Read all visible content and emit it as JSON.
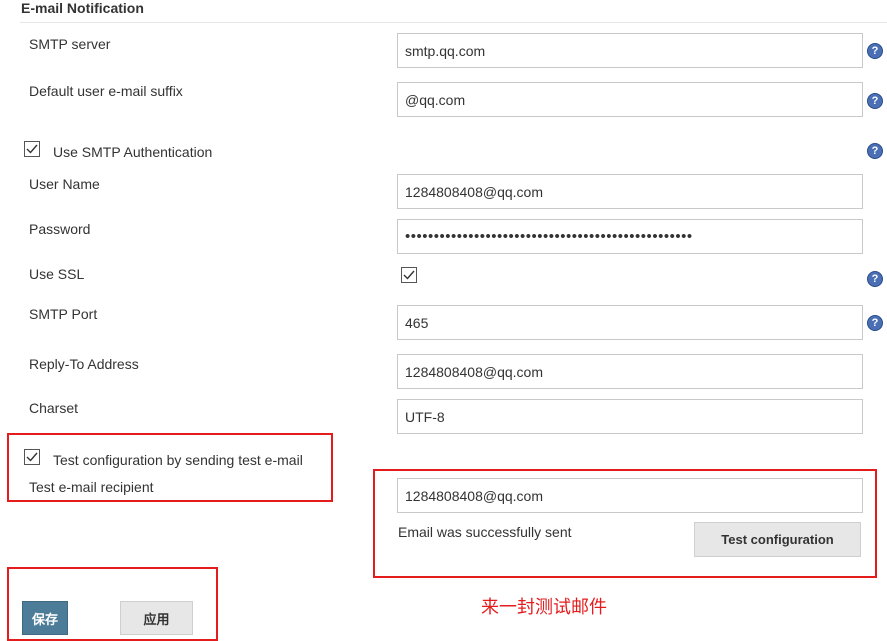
{
  "section": {
    "title": "E-mail Notification"
  },
  "fields": {
    "smtp_server": {
      "label": "SMTP server",
      "value": "smtp.qq.com"
    },
    "email_suffix": {
      "label": "Default user e-mail suffix",
      "value": "@qq.com"
    },
    "use_smtp_auth": {
      "label": "Use SMTP Authentication",
      "checked": true
    },
    "user_name": {
      "label": "User Name",
      "value": "1284808408@qq.com"
    },
    "password": {
      "label": "Password",
      "value": "••••••••••••••••••••••••••••••••••••••••••••••••••"
    },
    "use_ssl": {
      "label": "Use SSL",
      "checked": true
    },
    "smtp_port": {
      "label": "SMTP Port",
      "value": "465"
    },
    "reply_to": {
      "label": "Reply-To Address",
      "value": "1284808408@qq.com"
    },
    "charset": {
      "label": "Charset",
      "value": "UTF-8"
    }
  },
  "test": {
    "checkbox_label": "Test configuration by sending test e-mail",
    "checked": true,
    "recipient_label": "Test e-mail recipient",
    "recipient_value": "1284808408@qq.com",
    "status": "Email was successfully sent",
    "button": "Test configuration"
  },
  "actions": {
    "save": "保存",
    "apply": "应用"
  },
  "annotation": {
    "text": "来一封测试邮件",
    "color": "#e41c1c"
  },
  "colors": {
    "help_icon": "#4a6fb5",
    "save_button": "#4c7c98",
    "highlight": "#e41c1c"
  },
  "icons": {
    "help": "help-icon",
    "check": "checkmark-icon"
  }
}
